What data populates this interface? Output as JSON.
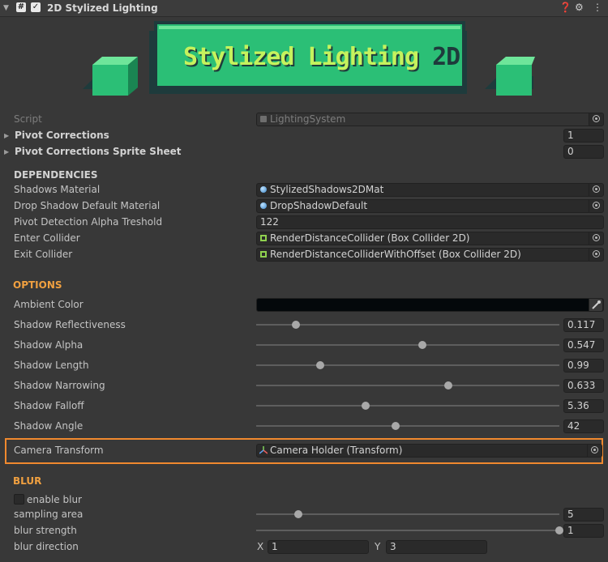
{
  "header": {
    "title": "2D Stylized Lighting",
    "enabled": true
  },
  "logo": {
    "text_main": "Stylized Lighting",
    "text_suffix": "2D"
  },
  "script": {
    "label": "Script",
    "value": "LightingSystem"
  },
  "pivot_corrections": {
    "label": "Pivot Corrections",
    "value": "1"
  },
  "pivot_corrections_sheet": {
    "label": "Pivot Corrections Sprite Sheet",
    "value": "0"
  },
  "dependencies": {
    "title": "DEPENDENCIES",
    "shadows_material": {
      "label": "Shadows Material",
      "value": "StylizedShadows2DMat"
    },
    "drop_shadow_material": {
      "label": "Drop Shadow Default Material",
      "value": "DropShadowDefault"
    },
    "pivot_alpha": {
      "label": "Pivot Detection Alpha Treshold",
      "value": "122"
    },
    "enter_collider": {
      "label": "Enter Collider",
      "value": "RenderDistanceCollider (Box Collider 2D)"
    },
    "exit_collider": {
      "label": "Exit Collider",
      "value": "RenderDistanceColliderWithOffset (Box Collider 2D)"
    }
  },
  "options": {
    "title": "OPTIONS",
    "ambient_color": {
      "label": "Ambient Color",
      "color": "#04080b"
    },
    "sliders": [
      {
        "label": "Shadow Reflectiveness",
        "value": "0.117",
        "fraction": 0.13
      },
      {
        "label": "Shadow Alpha",
        "value": "0.547",
        "fraction": 0.547
      },
      {
        "label": "Shadow Length",
        "value": "0.99",
        "fraction": 0.21
      },
      {
        "label": "Shadow Narrowing",
        "value": "0.633",
        "fraction": 0.633
      },
      {
        "label": "Shadow Falloff",
        "value": "5.36",
        "fraction": 0.36
      },
      {
        "label": "Shadow Angle",
        "value": "42",
        "fraction": 0.46
      }
    ],
    "camera_transform": {
      "label": "Camera Transform",
      "value": "Camera Holder (Transform)"
    }
  },
  "blur": {
    "title": "BLUR",
    "enable": {
      "label": "enable blur",
      "checked": false
    },
    "sampling_area": {
      "label": "sampling area",
      "value": "5",
      "fraction": 0.14
    },
    "blur_strength": {
      "label": "blur strength",
      "value": "1",
      "fraction": 1.0
    },
    "blur_direction": {
      "label": "blur direction",
      "x_label": "X",
      "x": "1",
      "y_label": "Y",
      "y": "3"
    }
  },
  "colors": {
    "section_accent": "#f0a040",
    "highlight": "#f0892e",
    "logo_green": "#2bbf76",
    "logo_dark": "#1e3b3c"
  },
  "icons": [
    "fold-arrow-icon",
    "script-icon",
    "help-icon",
    "settings-sliders-icon",
    "more-icon",
    "eyedropper-icon",
    "object-picker-icon"
  ]
}
